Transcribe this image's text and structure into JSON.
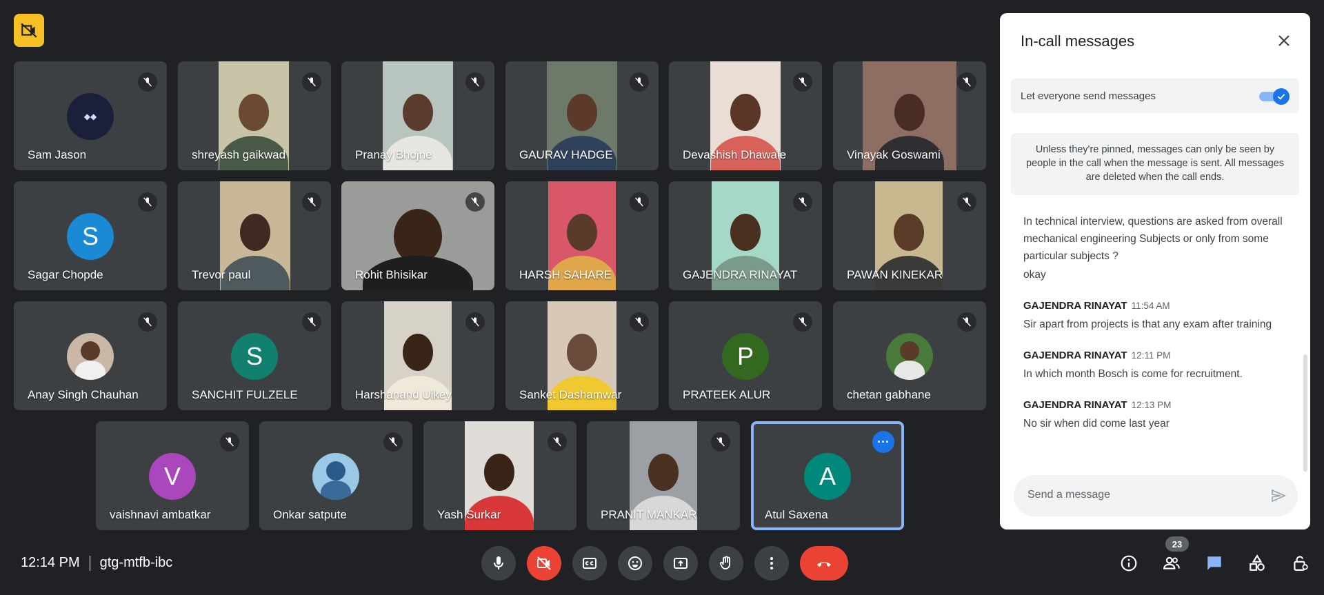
{
  "meeting": {
    "time": "12:14 PM",
    "code": "gtg-mtfb-ibc",
    "participant_count": "23"
  },
  "participants": [
    {
      "name": "Sam Jason"
    },
    {
      "name": "shreyash gaikwad"
    },
    {
      "name": "Pranay Bhojne"
    },
    {
      "name": "GAURAV HADGE"
    },
    {
      "name": "Devashish Dhawale"
    },
    {
      "name": "Vinayak Goswami"
    },
    {
      "name": "Sagar Chopde",
      "initial": "S"
    },
    {
      "name": "Trevor paul"
    },
    {
      "name": "Rohit Bhisikar"
    },
    {
      "name": "HARSH SAHARE"
    },
    {
      "name": "GAJENDRA RINAYAT"
    },
    {
      "name": "PAWAN KINEKAR"
    },
    {
      "name": "Anay Singh Chauhan"
    },
    {
      "name": "SANCHIT FULZELE",
      "initial": "S"
    },
    {
      "name": "Harshanand Uikey"
    },
    {
      "name": "Sanket Dashamwar"
    },
    {
      "name": "PRATEEK ALUR",
      "initial": "P"
    },
    {
      "name": "chetan gabhane"
    },
    {
      "name": "vaishnavi ambatkar",
      "initial": "V"
    },
    {
      "name": "Onkar satpute"
    },
    {
      "name": "Yash Surkar"
    },
    {
      "name": "PRANIT MANKAR"
    },
    {
      "name": "Atul Saxena",
      "initial": "A"
    }
  ],
  "chat": {
    "title": "In-call messages",
    "toggle_label": "Let everyone send messages",
    "notice": "Unless they're pinned, messages can only be seen by people in the call when the message is sent. All messages are deleted when the call ends.",
    "messages": [
      {
        "text": "In technical interview, questions are asked from overall mechanical engineering Subjects or only from some particular subjects ?"
      },
      {
        "text": "okay"
      },
      {
        "sender": "GAJENDRA RINAYAT",
        "time": "11:54 AM",
        "text": "Sir apart from projects is that any exam after training"
      },
      {
        "sender": "GAJENDRA RINAYAT",
        "time": "12:11 PM",
        "text": "In which month Bosch is come for recruitment."
      },
      {
        "sender": "GAJENDRA RINAYAT",
        "time": "12:13 PM",
        "text": "No sir when did  come last year"
      }
    ],
    "input_placeholder": "Send a message"
  },
  "colors": {
    "accent": "#1a73e8",
    "end_call": "#ea4335",
    "badge": "#f6c026"
  },
  "icons": {
    "top_left": "camera-off-badge-icon",
    "controls": [
      "mic-icon",
      "camera-off-icon",
      "captions-icon",
      "emoji-icon",
      "present-icon",
      "raise-hand-icon",
      "more-vert-icon",
      "end-call-icon"
    ],
    "right": [
      "info-icon",
      "people-icon",
      "chat-icon",
      "activities-icon",
      "host-controls-icon"
    ]
  }
}
